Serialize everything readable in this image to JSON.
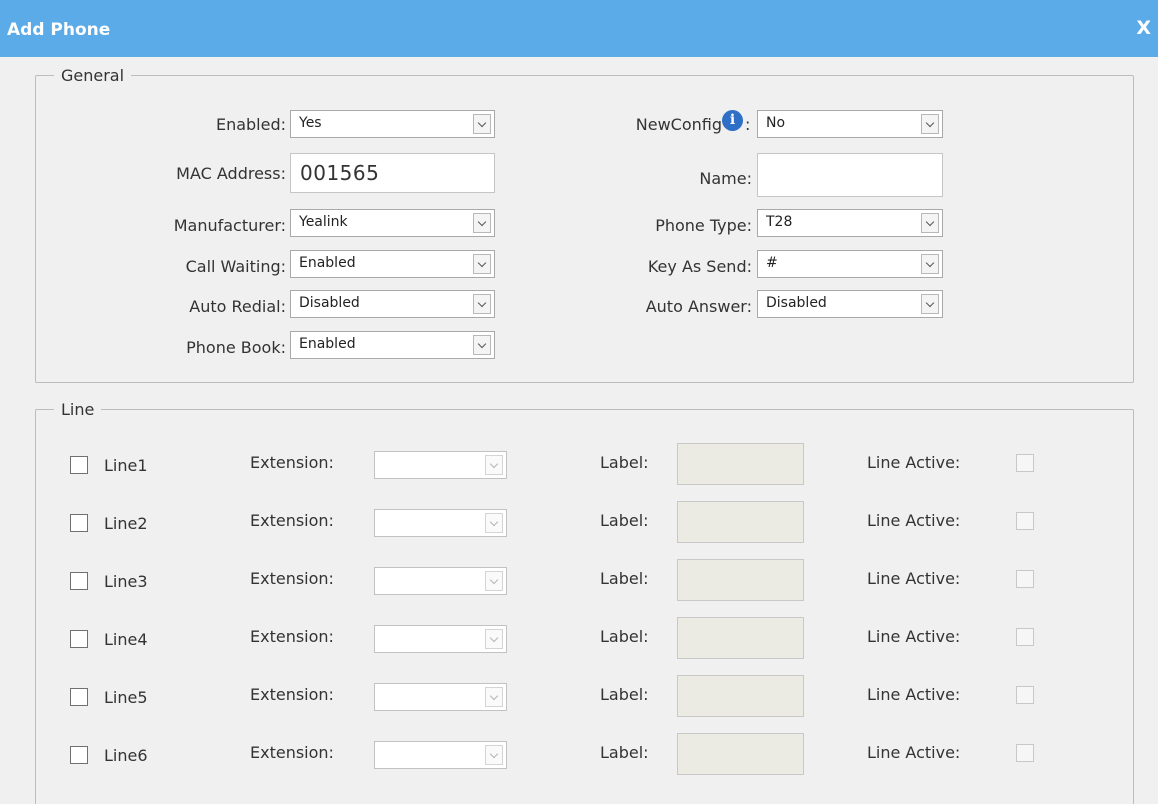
{
  "dialog": {
    "title": "Add Phone",
    "close_label": "X"
  },
  "general": {
    "legend": "General",
    "enabled": {
      "label": "Enabled:",
      "value": "Yes"
    },
    "new_config": {
      "label": "NewConfig",
      "colon": ":",
      "value": "No",
      "icon": "info-icon"
    },
    "mac": {
      "label": "MAC Address:",
      "value": "001565"
    },
    "name": {
      "label": "Name:",
      "value": ""
    },
    "manufacturer": {
      "label": "Manufacturer:",
      "value": "Yealink"
    },
    "phone_type": {
      "label": "Phone Type:",
      "value": "T28"
    },
    "call_waiting": {
      "label": "Call Waiting:",
      "value": "Enabled"
    },
    "key_as_send": {
      "label": "Key As Send:",
      "value": "#"
    },
    "auto_redial": {
      "label": "Auto Redial:",
      "value": "Disabled"
    },
    "auto_answer": {
      "label": "Auto Answer:",
      "value": "Disabled"
    },
    "phone_book": {
      "label": "Phone Book:",
      "value": "Enabled"
    }
  },
  "line": {
    "legend": "Line",
    "extension_label": "Extension:",
    "label_label": "Label:",
    "active_label": "Line Active:",
    "rows": [
      {
        "name": "Line1",
        "checked": false,
        "extension": "",
        "label": "",
        "active": false
      },
      {
        "name": "Line2",
        "checked": false,
        "extension": "",
        "label": "",
        "active": false
      },
      {
        "name": "Line3",
        "checked": false,
        "extension": "",
        "label": "",
        "active": false
      },
      {
        "name": "Line4",
        "checked": false,
        "extension": "",
        "label": "",
        "active": false
      },
      {
        "name": "Line5",
        "checked": false,
        "extension": "",
        "label": "",
        "active": false
      },
      {
        "name": "Line6",
        "checked": false,
        "extension": "",
        "label": "",
        "active": false
      }
    ]
  },
  "colors": {
    "titlebar": "#5aabe8",
    "panel": "#f0f0f0",
    "info_icon": "#2f6fc6"
  }
}
